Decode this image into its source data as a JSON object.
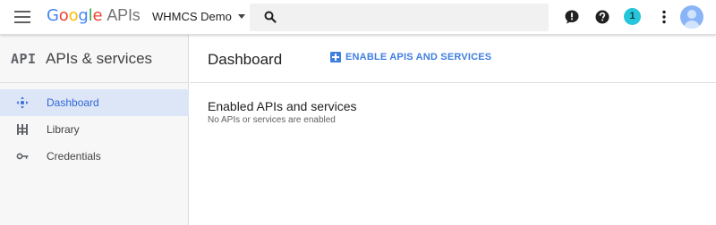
{
  "header": {
    "logo_letters": [
      {
        "char": "G",
        "color": "#4285F4"
      },
      {
        "char": "o",
        "color": "#EA4335"
      },
      {
        "char": "o",
        "color": "#FBBC05"
      },
      {
        "char": "g",
        "color": "#4285F4"
      },
      {
        "char": "l",
        "color": "#34A853"
      },
      {
        "char": "e",
        "color": "#EA4335"
      }
    ],
    "logo_suffix": "APIs",
    "project_name": "WHMCS Demo",
    "search_placeholder": "",
    "notification_count": "1",
    "icons": [
      "menu-icon",
      "search-icon",
      "feedback-icon",
      "help-icon",
      "more-vert-icon",
      "avatar"
    ]
  },
  "sidebar": {
    "glyph": "API",
    "title": "APIs & services",
    "items": [
      {
        "label": "Dashboard",
        "icon": "dashboard-icon",
        "active": true
      },
      {
        "label": "Library",
        "icon": "library-icon",
        "active": false
      },
      {
        "label": "Credentials",
        "icon": "key-icon",
        "active": false
      }
    ]
  },
  "main": {
    "title": "Dashboard",
    "enable_button": "ENABLE APIS AND SERVICES",
    "section_title": "Enabled APIs and services",
    "section_subtitle": "No APIs or services are enabled"
  },
  "colors": {
    "accent": "#3f7fe0",
    "active_bg": "#dce6f6",
    "notification_badge": "#26c6da"
  }
}
